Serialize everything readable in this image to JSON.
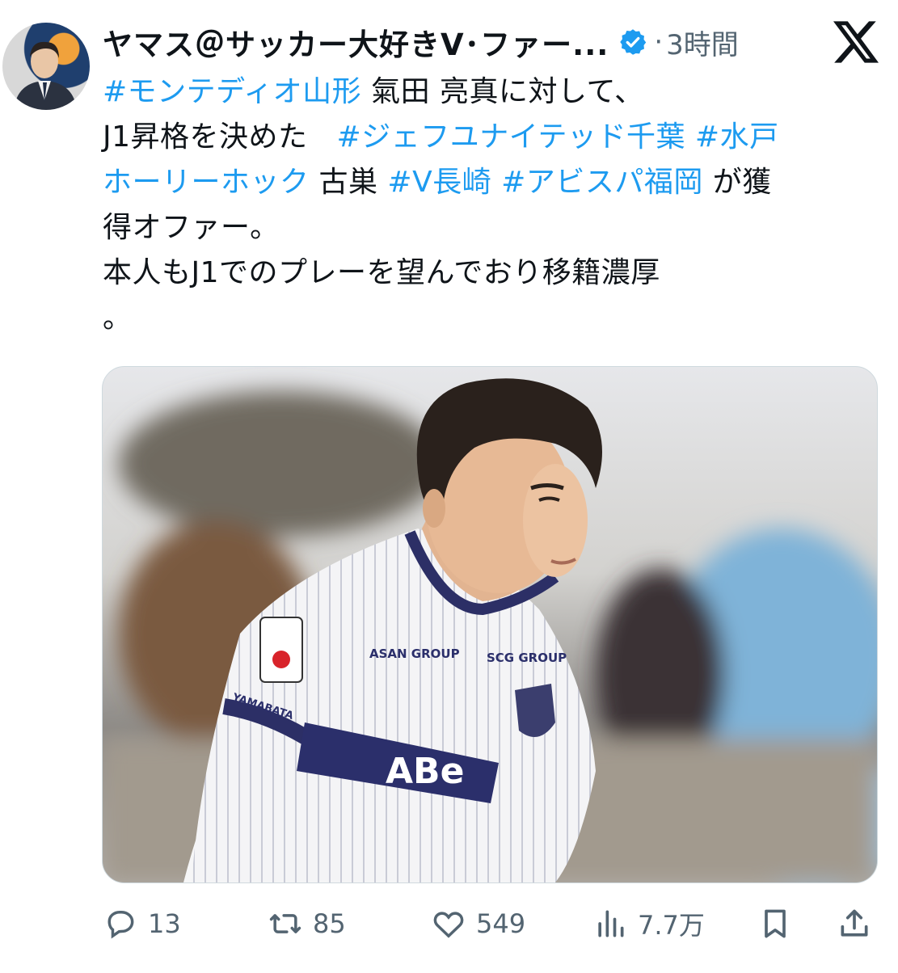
{
  "author": {
    "display_name": "ヤマス＠サッカー大好きV･ファー...",
    "time": "3時間",
    "separator": "·"
  },
  "text": {
    "line1": {
      "tag": "#モンテディオ山形",
      "rest": " 氣田 亮真に対して、"
    },
    "line2": {
      "plain": "J1昇格を決めた",
      "tag1": "#ジェフユナイテッド千葉",
      "tag2": " #水戸"
    },
    "line3": {
      "tag1": "ホーリーホック",
      "mid1": " 古巣 ",
      "tag2": "#V長崎",
      "mid2": " ",
      "tag3": "#アビスパ福岡",
      "rest": " が獲"
    },
    "line4": "得オファー。",
    "line5": "本人もJ1でのプレーを望んでおり移籍濃厚",
    "line6": "。"
  },
  "media": {
    "jersey_sponsor": "ABe",
    "jersey_left": "ASAN GROUP",
    "jersey_right": "SCG GROUP",
    "sleeve": "YAMABATA"
  },
  "actions": {
    "replies": "13",
    "reposts": "85",
    "likes": "549",
    "views": "7.7万"
  },
  "colors": {
    "link": "#1d9bf0",
    "verified": "#1d9bf0",
    "muted": "#536471"
  }
}
